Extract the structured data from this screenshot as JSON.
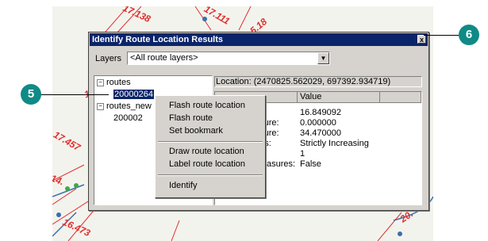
{
  "map_labels": [
    "17.138",
    "17.111",
    "5.18",
    "17.",
    "17.457",
    "14.",
    "16.473",
    "20."
  ],
  "dialog": {
    "title": "Identify Route Location Results",
    "close_glyph": "x",
    "layers_label": "Layers",
    "layers_value": "<All route layers>",
    "tree": {
      "routes": "routes",
      "route_id": "20000264",
      "routes_new": "routes_new",
      "routes_new_child": "200002"
    },
    "location": "Location: (2470825.562029, 697392.934719)",
    "grid": {
      "value_header": "Value",
      "rows": [
        {
          "field": "",
          "value": "16.849092"
        },
        {
          "field": "asure:",
          "value": "0.000000"
        },
        {
          "field": "asure:",
          "value": "34.470000"
        },
        {
          "field": "ues:",
          "value": "Strictly Increasing"
        },
        {
          "field": "",
          "value": "1"
        },
        {
          "field": "asures:",
          "value": "False"
        }
      ]
    }
  },
  "context_menu": {
    "items": [
      "Flash route location",
      "Flash route",
      "Set bookmark",
      "Draw route  location",
      "Label route location",
      "Identify"
    ]
  },
  "callouts": {
    "five": "5",
    "six": "6"
  },
  "colors": {
    "titlebar": "#0a246a",
    "callout": "#0f8a86",
    "map_label": "#e0302e"
  }
}
